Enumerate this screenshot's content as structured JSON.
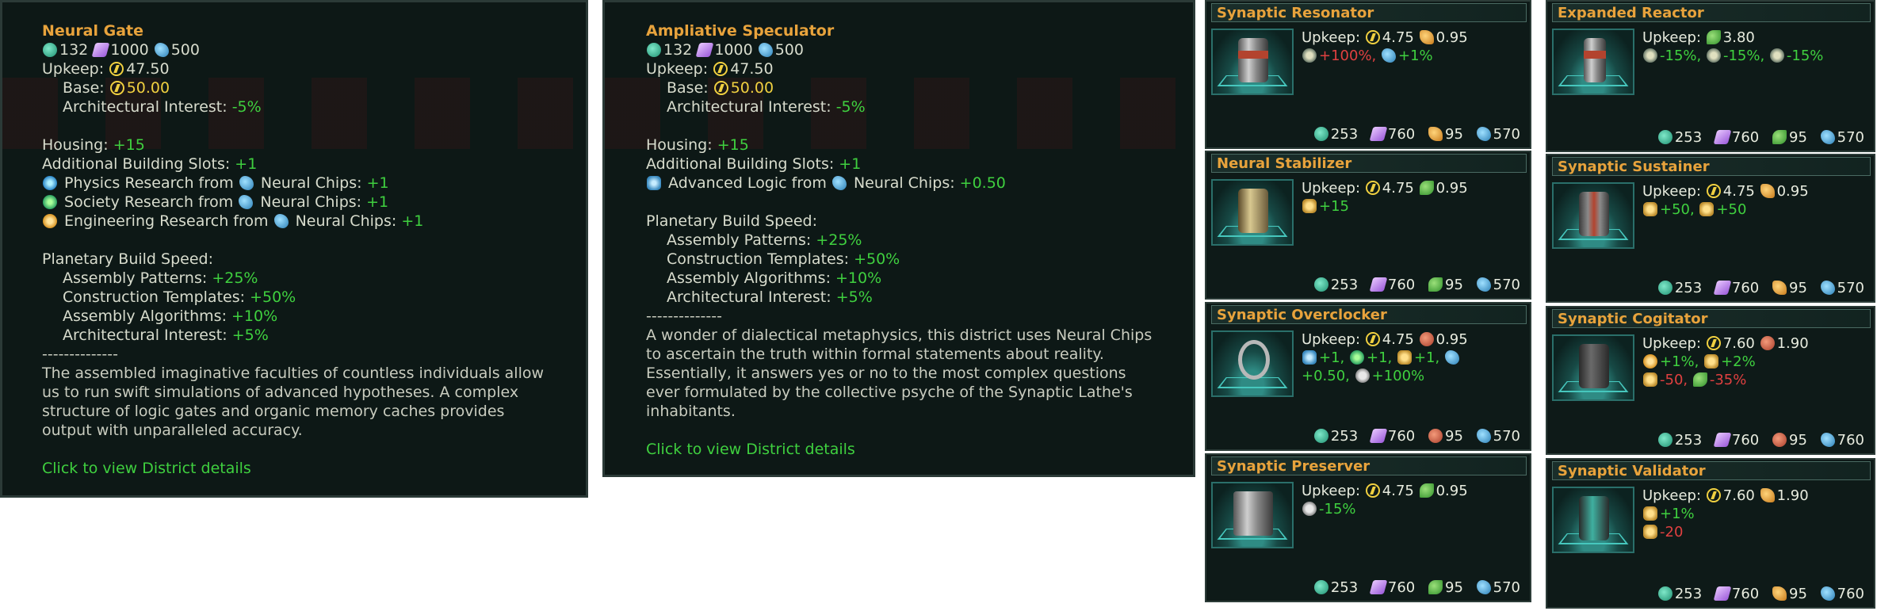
{
  "tooltip1": {
    "title": "Neural Gate",
    "cost": [
      "132",
      "1000",
      "500"
    ],
    "upkeep_label": "Upkeep:",
    "upkeep_value": "47.50",
    "base_label": "Base:",
    "base_value": "50.00",
    "arch_label": "Architectural Interest:",
    "arch_value": "-5%",
    "housing_label": "Housing:",
    "housing_value": "+15",
    "slots_label": "Additional Building Slots:",
    "slots_value": "+1",
    "research": [
      {
        "pre": "Physics Research from",
        "post": "Neural Chips:",
        "value": "+1",
        "icon": "physics-research-icon"
      },
      {
        "pre": "Society Research from",
        "post": "Neural Chips:",
        "value": "+1",
        "icon": "society-research-icon"
      },
      {
        "pre": "Engineering Research from",
        "post": "Neural Chips:",
        "value": "+1",
        "icon": "engineering-research-icon"
      }
    ],
    "build_speed_label": "Planetary Build Speed:",
    "build_speed": [
      {
        "label": "Assembly Patterns:",
        "value": "+25%"
      },
      {
        "label": "Construction Templates:",
        "value": "+50%"
      },
      {
        "label": "Assembly Algorithms:",
        "value": "+10%"
      },
      {
        "label": "Architectural Interest:",
        "value": "+5%"
      }
    ],
    "separator": "--------------",
    "description": "The assembled imaginative faculties of countless individuals allow us to run swift simulations of advanced hypotheses. A complex structure of logic gates and organic memory caches provides output with unparalleled accuracy.",
    "link": "Click to view District details"
  },
  "tooltip2": {
    "title": "Ampliative Speculator",
    "cost": [
      "132",
      "1000",
      "500"
    ],
    "upkeep_label": "Upkeep:",
    "upkeep_value": "47.50",
    "base_label": "Base:",
    "base_value": "50.00",
    "arch_label": "Architectural Interest:",
    "arch_value": "-5%",
    "housing_label": "Housing:",
    "housing_value": "+15",
    "slots_label": "Additional Building Slots:",
    "slots_value": "+1",
    "logic_pre": "Advanced Logic from",
    "logic_post": "Neural Chips:",
    "logic_value": "+0.50",
    "build_speed_label": "Planetary Build Speed:",
    "build_speed": [
      {
        "label": "Assembly Patterns:",
        "value": "+25%"
      },
      {
        "label": "Construction Templates:",
        "value": "+50%"
      },
      {
        "label": "Assembly Algorithms:",
        "value": "+10%"
      },
      {
        "label": "Architectural Interest:",
        "value": "+5%"
      }
    ],
    "separator": "--------------",
    "description": "A wonder of dialectical metaphysics, this district uses Neural Chips to ascertain the truth within formal statements about reality. Essentially, it answers yes or no to the most complex questions ever formulated by the collective psyche of the Synaptic Lathe's inhabitants.",
    "link": "Click to view District details"
  },
  "cards": [
    {
      "title": "Synaptic Resonator",
      "upkeep": [
        "4.75",
        "0.95"
      ],
      "effects": [
        "+100%, ",
        "+1%"
      ],
      "effects2": [],
      "foot": [
        "253",
        "760",
        "95",
        "570"
      ]
    },
    {
      "title": "Neural Stabilizer",
      "upkeep": [
        "4.75",
        "0.95"
      ],
      "effects": [
        "+15"
      ],
      "effects2": [],
      "foot": [
        "253",
        "760",
        "95",
        "570"
      ]
    },
    {
      "title": "Synaptic Overclocker",
      "upkeep": [
        "4.75",
        "0.95"
      ],
      "effects": [
        "+1, ",
        "+1, ",
        "+1, "
      ],
      "effects2": [
        "+0.50, ",
        "+100%"
      ],
      "foot": [
        "253",
        "760",
        "95",
        "570"
      ]
    },
    {
      "title": "Synaptic Preserver",
      "upkeep": [
        "4.75",
        "0.95"
      ],
      "effects": [
        "-15%"
      ],
      "effects2": [],
      "foot": [
        "253",
        "760",
        "95",
        "570"
      ]
    },
    {
      "title": "Expanded Reactor",
      "upkeep": [
        "3.80"
      ],
      "effects": [
        "-15%, ",
        "-15%, ",
        "-15%"
      ],
      "effects2": [],
      "foot": [
        "253",
        "760",
        "95",
        "570"
      ]
    },
    {
      "title": "Synaptic Sustainer",
      "upkeep": [
        "4.75",
        "0.95"
      ],
      "effects": [
        "+50, ",
        "+50"
      ],
      "effects2": [],
      "foot": [
        "253",
        "760",
        "95",
        "570"
      ]
    },
    {
      "title": "Synaptic Cogitator",
      "upkeep": [
        "7.60",
        "1.90"
      ],
      "effects": [
        "+1%, ",
        "+2%"
      ],
      "effects2": [
        "-50, ",
        "-35%"
      ],
      "foot": [
        "253",
        "760",
        "95",
        "760"
      ]
    },
    {
      "title": "Synaptic Validator",
      "upkeep": [
        "7.60",
        "1.90"
      ],
      "effects": [
        "+1%"
      ],
      "effects2": [
        "-20"
      ],
      "foot": [
        "253",
        "760",
        "95",
        "760"
      ]
    }
  ],
  "upkeep_label": "Upkeep:",
  "colors": {
    "title": "#e8a33c",
    "positive": "#3fd03f",
    "negative": "#e04040"
  }
}
